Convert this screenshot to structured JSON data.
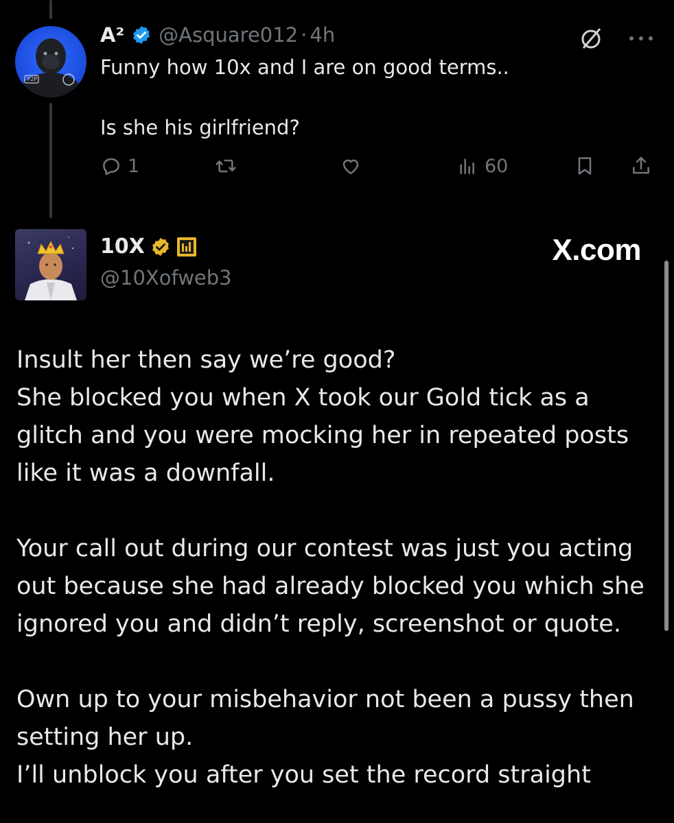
{
  "tweet1": {
    "display_name": "A²",
    "handle": "@Asquare012",
    "separator": "·",
    "time": "4h",
    "avatar_badge": "P2P",
    "body": [
      "Funny how 10x and I are on good terms..",
      "Is she his girlfriend?"
    ],
    "actions": {
      "reply_count": "1",
      "views_count": "60"
    },
    "icons": {
      "grok": "grok-icon",
      "more": "more-icon",
      "reply": "reply-icon",
      "retweet": "retweet-icon",
      "like": "like-icon",
      "views": "views-icon",
      "bookmark": "bookmark-icon",
      "share": "share-icon"
    }
  },
  "tweet2": {
    "display_name": "10X",
    "handle": "@10Xofweb3",
    "verified_color": "#e8b62c",
    "body_paragraphs": [
      [
        "Insult her then say we’re good?",
        "She blocked you when X took our Gold tick as a glitch and you were mocking her in repeated posts like it was a downfall."
      ],
      [
        "Your call out during our contest was just you acting out because she had already blocked you which she ignored you and didn’t reply, screenshot or quote."
      ],
      [
        "Own up to your misbehavior not been a pussy then setting her up.",
        "I’ll unblock you after you set the record straight"
      ]
    ]
  },
  "watermark": "X.com",
  "colors": {
    "background": "#000000",
    "text": "#e7e9ea",
    "muted": "#71767b",
    "blue_check": "#1d9bf0",
    "gold_check": "#e8b62c"
  }
}
